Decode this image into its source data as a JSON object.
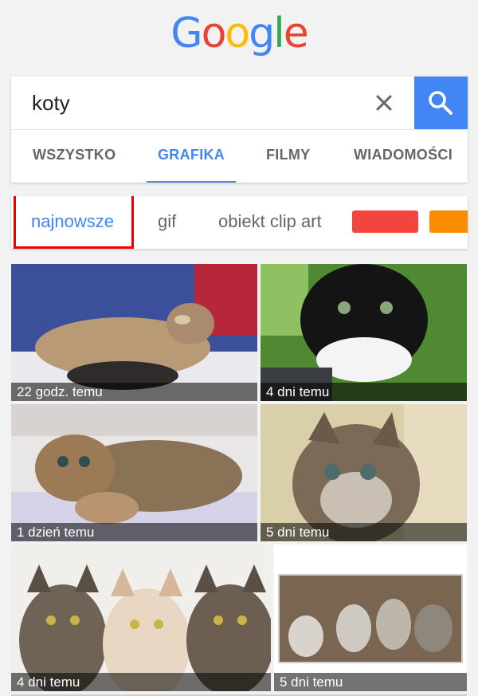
{
  "logo": {
    "letters": [
      {
        "char": "G",
        "color": "#4285f4"
      },
      {
        "char": "o",
        "color": "#ea4335"
      },
      {
        "char": "o",
        "color": "#fbbc05"
      },
      {
        "char": "g",
        "color": "#4285f4"
      },
      {
        "char": "l",
        "color": "#34a853"
      },
      {
        "char": "e",
        "color": "#ea4335"
      }
    ]
  },
  "search": {
    "query": "koty",
    "clear_icon": "close-icon",
    "submit_icon": "search-icon",
    "submit_color": "#4285f4"
  },
  "tabs": [
    {
      "label": "WSZYSTKO",
      "active": false
    },
    {
      "label": "GRAFIKA",
      "active": true
    },
    {
      "label": "FILMY",
      "active": false
    },
    {
      "label": "WIADOMOŚCI",
      "active": false
    }
  ],
  "chips": [
    {
      "label": "najnowsze",
      "selected": true
    },
    {
      "label": "gif",
      "selected": false
    },
    {
      "label": "obiekt clip art",
      "selected": false
    }
  ],
  "color_filters": [
    "#f1453d",
    "#fb8c00"
  ],
  "results": [
    {
      "caption": "22 godz. temu"
    },
    {
      "caption": "4 dni temu"
    },
    {
      "caption": "1 dzień temu"
    },
    {
      "caption": "5 dni temu"
    },
    {
      "caption": "4 dni temu"
    },
    {
      "caption": "5 dni temu"
    }
  ]
}
